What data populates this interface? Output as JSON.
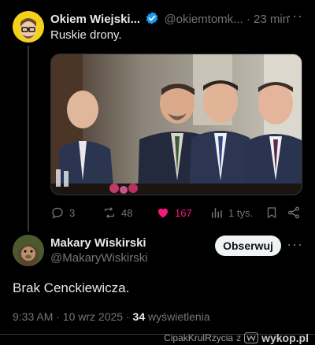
{
  "tweet": {
    "author_name": "Okiem Wiejski...",
    "handle": "@okiemtomk...",
    "dot": "·",
    "time": "23 min",
    "text": "Ruskie drony.",
    "actions": {
      "replies": "3",
      "reposts": "48",
      "likes": "167",
      "views": "1 tys."
    }
  },
  "reply": {
    "author_name": "Makary Wiskirski",
    "handle": "@MakaryWiskirski",
    "follow_label": "Obserwuj",
    "text": "Brak Cenckiewicza.",
    "timestamp": "9:33 AM · 10 wrz 2025 ·",
    "views_count": "34",
    "views_label": "wyświetlenia"
  },
  "footer": {
    "user": "CipakKrulRzycia",
    "prep": "z",
    "site": "wykop.pl"
  },
  "colors": {
    "background": "#000000",
    "verified": "#1d9bf0",
    "like": "#f91880",
    "follow_bg": "#eff3f4"
  },
  "icons": [
    "verified-badge-icon",
    "more-icon",
    "reply-icon",
    "repost-icon",
    "like-icon",
    "views-icon",
    "bookmark-icon",
    "share-icon",
    "wykop-logo-icon"
  ]
}
